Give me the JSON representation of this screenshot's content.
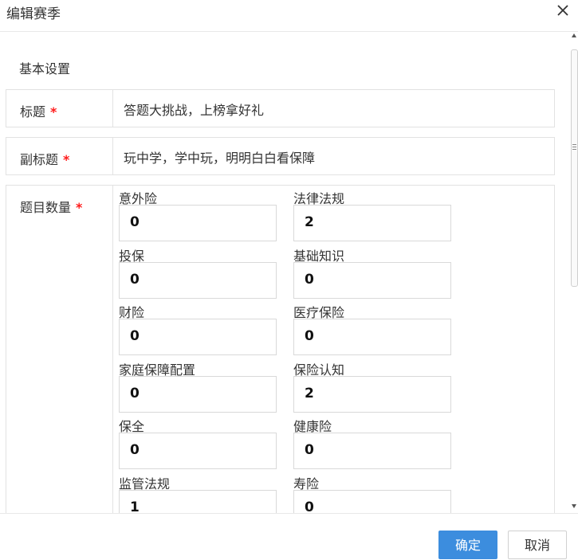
{
  "dialog": {
    "title": "编辑赛季"
  },
  "section": {
    "title": "基本设置"
  },
  "fields": {
    "title_label": "标题",
    "title_value": "答题大挑战，上榜拿好礼",
    "subtitle_label": "副标题",
    "subtitle_value": "玩中学，学中玩，明明白白看保障",
    "qty_label": "题目数量",
    "required_mark": "*"
  },
  "categories": [
    {
      "left": {
        "name": "意外险",
        "value": "0"
      },
      "right": {
        "name": "法律法规",
        "value": "2"
      }
    },
    {
      "left": {
        "name": "投保",
        "value": "0"
      },
      "right": {
        "name": "基础知识",
        "value": "0"
      }
    },
    {
      "left": {
        "name": "财险",
        "value": "0"
      },
      "right": {
        "name": "医疗保险",
        "value": "0"
      }
    },
    {
      "left": {
        "name": "家庭保障配置",
        "value": "0"
      },
      "right": {
        "name": "保险认知",
        "value": "2"
      }
    },
    {
      "left": {
        "name": "保全",
        "value": "0"
      },
      "right": {
        "name": "健康险",
        "value": "0"
      }
    },
    {
      "left": {
        "name": "监管法规",
        "value": "1"
      },
      "right": {
        "name": "寿险",
        "value": "0"
      }
    }
  ],
  "footer": {
    "confirm_label": "确定",
    "cancel_label": "取消"
  },
  "colors": {
    "primary": "#3c8dde",
    "required": "#ff1a1a"
  }
}
